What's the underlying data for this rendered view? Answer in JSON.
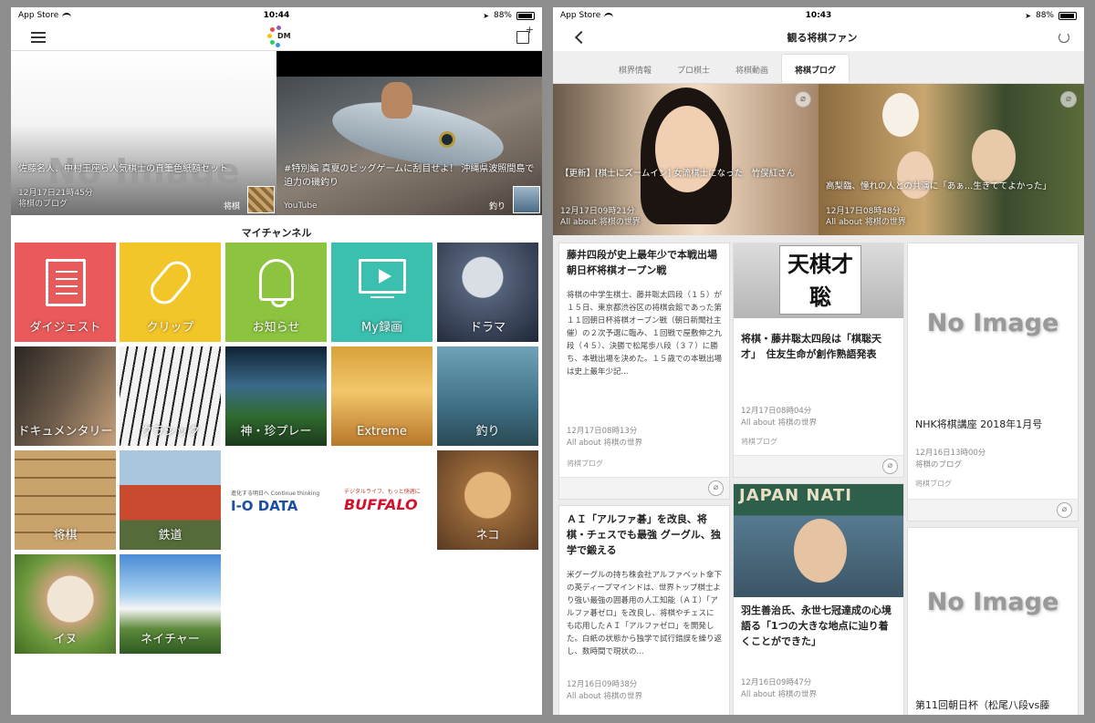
{
  "left": {
    "status": {
      "carrier": "App Store",
      "time": "10:44",
      "battery": "88%"
    },
    "logo_text": "DM",
    "hero": [
      {
        "title": "佐藤名人、中村王座ら人気棋士の直筆色紙額セット",
        "time": "12月17日21時45分",
        "source": "将棋のブログ",
        "tag": "将棋",
        "noimage": "No Image"
      },
      {
        "title": "#特別編 真夏のビッグゲームに刮目せよ！ 沖縄県波照間島で迫力の磯釣り",
        "source": "YouTube",
        "tag": "釣り"
      }
    ],
    "mychannel_title": "マイチャンネル",
    "tiles": [
      {
        "label": "ダイジェスト",
        "color": "#ea5a5a"
      },
      {
        "label": "クリップ",
        "color": "#f2c529"
      },
      {
        "label": "お知らせ",
        "color": "#8cc43f"
      },
      {
        "label": "My録画",
        "color": "#3bbfae"
      },
      {
        "label": "ドラマ"
      },
      {
        "label": "ドキュメンタリー"
      },
      {
        "label": "クラシック"
      },
      {
        "label": "神・珍プレー"
      },
      {
        "label": "Extreme"
      },
      {
        "label": "釣り"
      },
      {
        "label": "将棋"
      },
      {
        "label": "鉄道"
      },
      {
        "label": "ネコ"
      },
      {
        "label": "イヌ"
      },
      {
        "label": "ネイチャー"
      }
    ],
    "sponsors": {
      "iodata_tagline": "進化する明日へ Continue thinking",
      "iodata": "I-O DATA",
      "buffalo_tagline": "デジタルライフ、もっと快適に",
      "buffalo": "BUFFALO"
    }
  },
  "right": {
    "status": {
      "carrier": "App Store",
      "time": "10:43",
      "battery": "88%"
    },
    "title": "観る将棋ファン",
    "tabs": [
      "棋界情報",
      "プロ棋士",
      "将棋動画",
      "将棋ブログ"
    ],
    "active_tab": "将棋ブログ",
    "hero": [
      {
        "title": "【更新】[棋士にズームイン] 女流棋士になった　竹俣紅さん",
        "time": "12月17日09時21分",
        "source": "All about 将棋の世界"
      },
      {
        "title": "高梨臨、憧れの人との共演に「あぁ…生きててよかった」",
        "time": "12月17日08時48分",
        "source": "All about 将棋の世界"
      }
    ],
    "cards": [
      {
        "title": "藤井四段が史上最年少で本戦出場　朝日杯将棋オープン戦",
        "desc": "将棋の中学生棋士、藤井聡太四段（１５）が１５日、東京都渋谷区の将棋会館であった第１１回朝日杯将棋オープン戦（朝日新聞社主催）の２次予選に臨み、１回戦で屋敷伸之九段（４５）、決勝で松尾歩八段（３７）に勝ち、本戦出場を決めた。１５歳での本戦出場は史上最年少記...",
        "time": "12月17日08時13分",
        "source": "All about 将棋の世界",
        "tag": "将棋ブログ"
      },
      {
        "title": "将棋・藤井聡太四段は「棋聡天才」　住友生命が創作熟語発表",
        "time": "12月17日08時04分",
        "source": "All about 将棋の世界",
        "tag": "将棋ブログ",
        "img_text": "天棋才聡"
      },
      {
        "title": "NHK将棋講座 2018年1月号",
        "time": "12月16日13時00分",
        "source": "将棋のブログ",
        "tag": "将棋ブログ",
        "noimage": "No Image"
      },
      {
        "title": "ＡＩ「アルファ碁」を改良、将棋・チェスでも最強 グーグル、独学で鍛える",
        "desc": "米グーグルの持ち株会社アルファベット傘下の英ディープマインドは、世界トップ棋士より強い最強の囲碁用の人工知能（ＡＩ）「アルファ碁ゼロ」を改良し、将棋やチェスにも応用したＡＩ「アルファゼロ」を開発した。白紙の状態から独学で試行錯誤を繰り返し、数時間で現状の...",
        "time": "12月16日09時38分",
        "source": "All about 将棋の世界"
      },
      {
        "title": "羽生善治氏、永世七冠達成の心境語る「1つの大きな地点に辿り着くことができた」",
        "time": "12月16日09時47分",
        "source": "All about 将棋の世界",
        "img_text": "JAPAN NATI"
      },
      {
        "title": "第11回朝日杯（松尾八段vs藤",
        "noimage": "No Image"
      }
    ]
  }
}
